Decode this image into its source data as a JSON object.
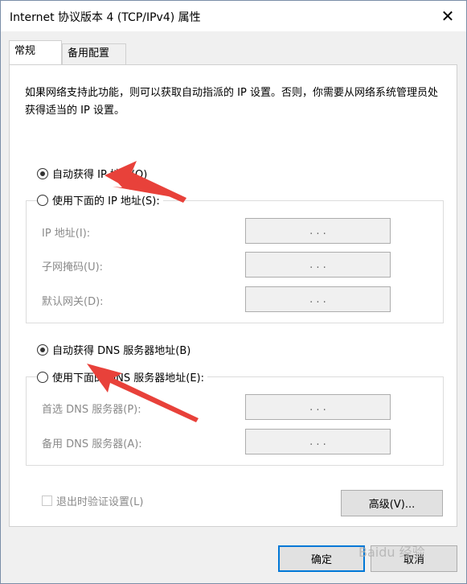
{
  "window": {
    "title": "Internet 协议版本 4 (TCP/IPv4) 属性",
    "close_glyph": "✕"
  },
  "tabs": [
    {
      "label": "常规"
    },
    {
      "label": "备用配置"
    }
  ],
  "description": "如果网络支持此功能，则可以获取自动指派的 IP 设置。否则，你需要从网络系统管理员处获得适当的 IP 设置。",
  "ip_section": {
    "auto_label": "自动获得 IP 地址(O)",
    "manual_label": "使用下面的 IP 地址(S):",
    "auto_selected": true,
    "fields": [
      {
        "label": "IP 地址(I):",
        "value": ".   .   ."
      },
      {
        "label": "子网掩码(U):",
        "value": ".   .   ."
      },
      {
        "label": "默认网关(D):",
        "value": ".   .   ."
      }
    ]
  },
  "dns_section": {
    "auto_label": "自动获得 DNS 服务器地址(B)",
    "manual_label": "使用下面的 DNS 服务器地址(E):",
    "auto_selected": true,
    "fields": [
      {
        "label": "首选 DNS 服务器(P):",
        "value": ".   .   ."
      },
      {
        "label": "备用 DNS 服务器(A):",
        "value": ".   .   ."
      }
    ]
  },
  "validate_label": "退出时验证设置(L)",
  "buttons": {
    "advanced": "高级(V)...",
    "ok": "确定",
    "cancel": "取消"
  },
  "watermark": "Baidu 经验",
  "colors": {
    "accent": "#0078d7",
    "annotation_arrow": "#e8413a"
  }
}
